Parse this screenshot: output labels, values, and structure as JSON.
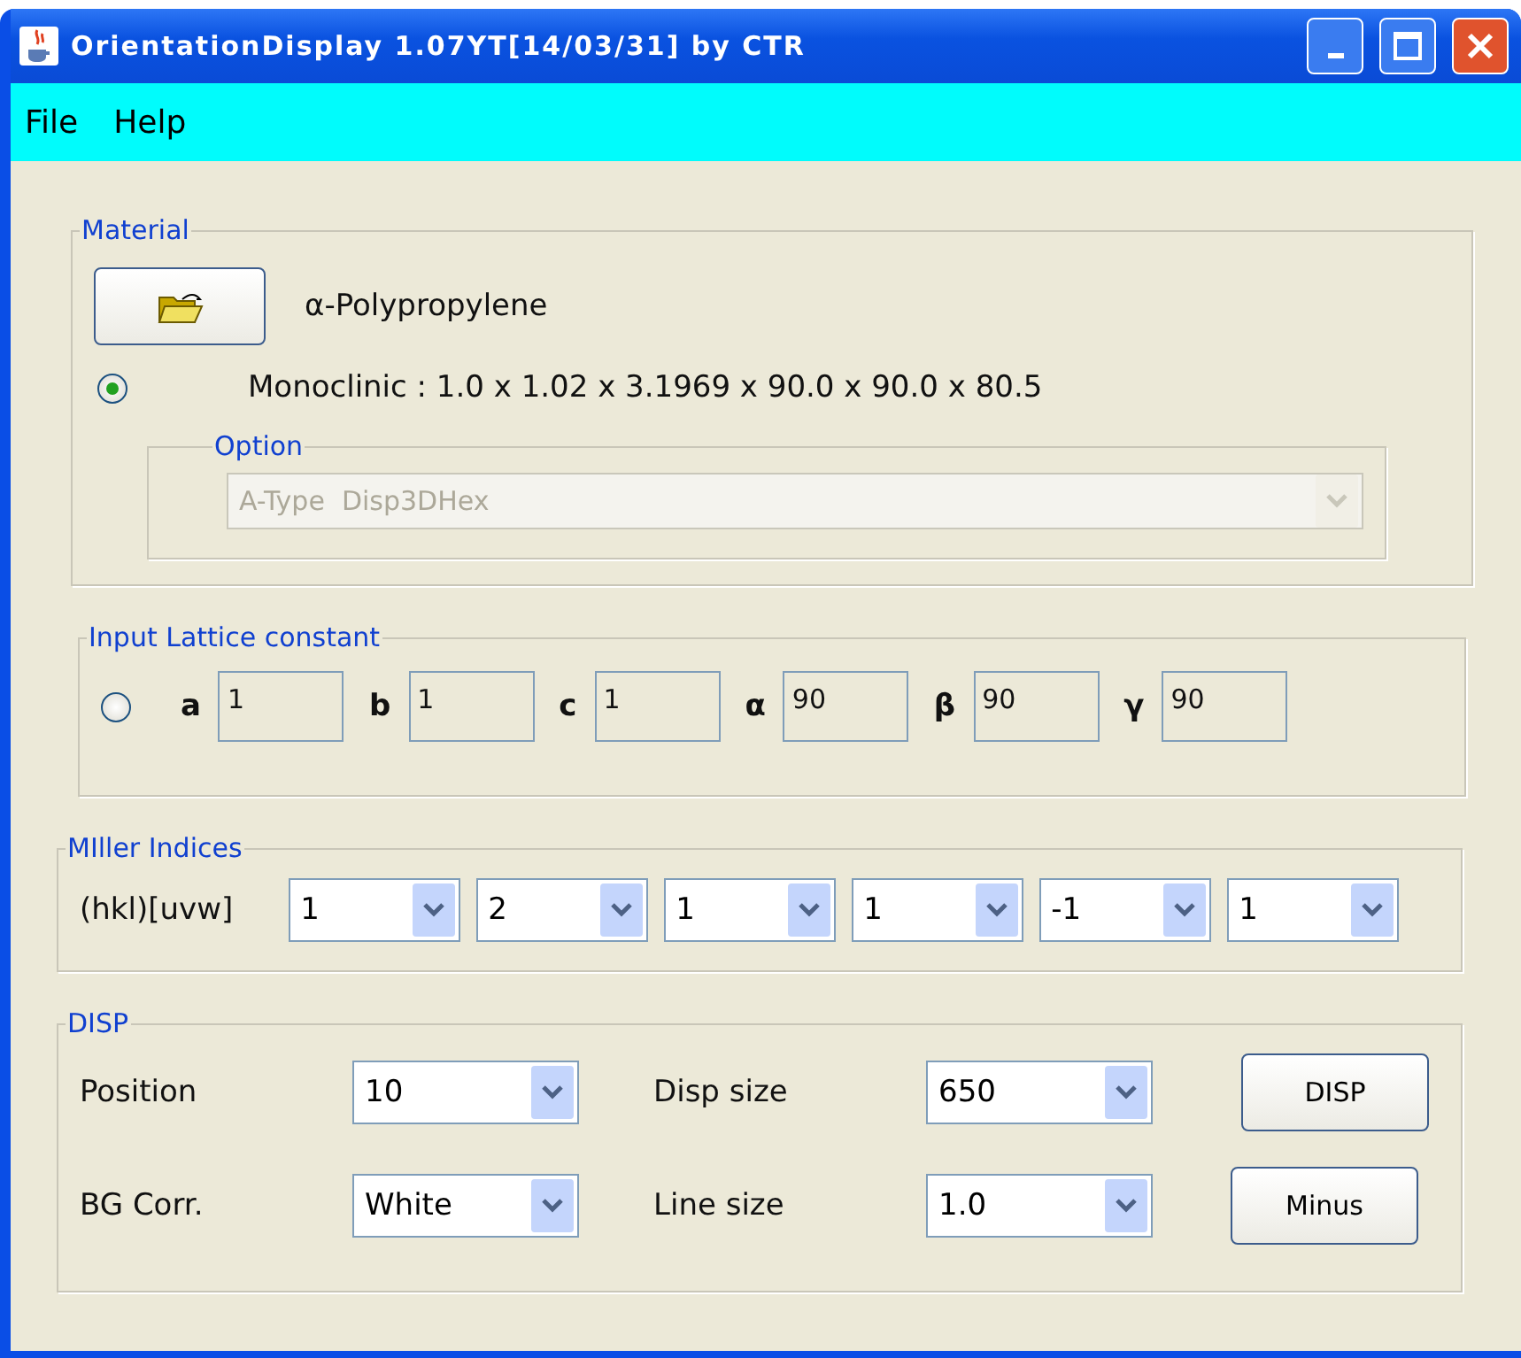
{
  "window": {
    "title": "OrientationDisplay 1.07YT[14/03/31] by CTR"
  },
  "menu": [
    {
      "label": "File"
    },
    {
      "label": "Help"
    }
  ],
  "material": {
    "title": "Material",
    "name": "α-Polypropylene",
    "preset": {
      "selected": true,
      "label": "Monoclinic : 1.0 x 1.02 x 3.1969 x 90.0 x 90.0 x 80.5"
    },
    "option": {
      "title": "Option",
      "value": "A-Type  Disp3DHex",
      "disabled": true
    }
  },
  "lattice": {
    "title": "Input Lattice constant",
    "selected": false,
    "fields": [
      {
        "label": "a",
        "value": "1"
      },
      {
        "label": "b",
        "value": "1"
      },
      {
        "label": "c",
        "value": "1"
      },
      {
        "label": "α",
        "value": "90"
      },
      {
        "label": "β",
        "value": "90"
      },
      {
        "label": "γ",
        "value": "90"
      }
    ]
  },
  "miller": {
    "title": "MIller Indices",
    "label": "(hkl)[uvw]",
    "indices": [
      "1",
      "2",
      "1",
      "1",
      "-1",
      "1"
    ]
  },
  "disp": {
    "title": "DISP",
    "rows": [
      {
        "label": "Position",
        "value": "10",
        "label2": "Disp size",
        "value2": "650",
        "button": "DISP"
      },
      {
        "label": "BG Corr.",
        "value": "White",
        "label2": "Line size",
        "value2": "1.0",
        "button": "Minus"
      }
    ]
  }
}
